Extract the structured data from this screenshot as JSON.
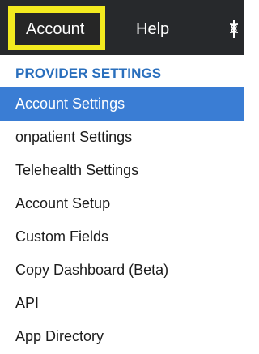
{
  "topnav": {
    "account_label": "Account",
    "help_label": "Help",
    "icon": "caduceus-icon"
  },
  "menu": {
    "heading": "PROVIDER SETTINGS",
    "items": [
      {
        "label": "Account Settings",
        "active": true
      },
      {
        "label": "onpatient Settings",
        "active": false
      },
      {
        "label": "Telehealth Settings",
        "active": false
      },
      {
        "label": "Account Setup",
        "active": false
      },
      {
        "label": "Custom Fields",
        "active": false
      },
      {
        "label": "Copy Dashboard (Beta)",
        "active": false
      },
      {
        "label": "API",
        "active": false
      },
      {
        "label": "App Directory",
        "active": false
      }
    ]
  },
  "colors": {
    "nav_background": "#27292c",
    "highlight": "#f3ea1f",
    "heading": "#2a6fbd",
    "active_item": "#3a7dd4"
  }
}
